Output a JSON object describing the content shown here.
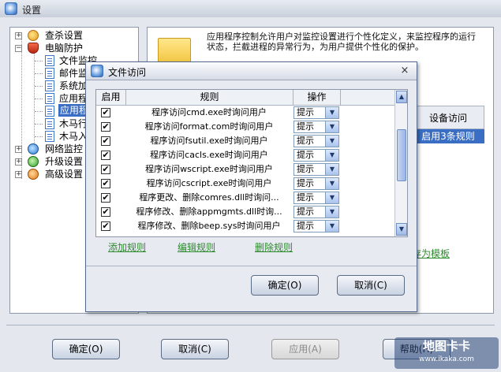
{
  "window": {
    "title": "设置"
  },
  "tree": {
    "items": [
      {
        "label": "查杀设置",
        "icon": "scan-settings-icon"
      },
      {
        "label": "电脑防护",
        "icon": "shield-icon"
      },
      {
        "label": "文件监控",
        "icon": "document-icon"
      },
      {
        "label": "邮件监控",
        "icon": "document-icon"
      },
      {
        "label": "系统加固",
        "icon": "document-icon"
      },
      {
        "label": "应用程序",
        "icon": "document-icon"
      },
      {
        "label": "应用程序",
        "icon": "document-icon"
      },
      {
        "label": "木马行为",
        "icon": "document-icon"
      },
      {
        "label": "木马入侵",
        "icon": "document-icon"
      },
      {
        "label": "网络监控",
        "icon": "network-icon"
      },
      {
        "label": "升级设置",
        "icon": "update-icon"
      },
      {
        "label": "高级设置",
        "icon": "advanced-settings-icon"
      }
    ]
  },
  "main": {
    "description": "应用程序控制允许用户对监控设置进行个性化定义，来监控程序的运行状态，拦截进程的异常行为，为用户提供个性化的保护。",
    "column_header": "设备访问",
    "selected_cell": "启用3条规则",
    "save_template_link": "存为模板"
  },
  "dialog": {
    "title": "文件访问",
    "close_symbol": "×",
    "columns": [
      "启用",
      "规则",
      "操作"
    ],
    "rows": [
      {
        "checked": "✔",
        "rule": "程序访问cmd.exe时询问用户",
        "action": "提示"
      },
      {
        "checked": "✔",
        "rule": "程序访问format.com时询问用户",
        "action": "提示"
      },
      {
        "checked": "✔",
        "rule": "程序访问fsutil.exe时询问用户",
        "action": "提示"
      },
      {
        "checked": "✔",
        "rule": "程序访问cacls.exe时询问用户",
        "action": "提示"
      },
      {
        "checked": "✔",
        "rule": "程序访问wscript.exe时询问用户",
        "action": "提示"
      },
      {
        "checked": "✔",
        "rule": "程序访问cscript.exe时询问用户",
        "action": "提示"
      },
      {
        "checked": "✔",
        "rule": "程序更改、删除comres.dll时询问...",
        "action": "提示"
      },
      {
        "checked": "✔",
        "rule": "程序修改、删除appmgmts.dll时询...",
        "action": "提示"
      },
      {
        "checked": "✔",
        "rule": "程序修改、删除beep.sys时询问用户",
        "action": "提示"
      }
    ],
    "links": {
      "add": "添加规则",
      "edit": "编辑规则",
      "delete": "删除规则"
    },
    "buttons": {
      "ok": "确定(O)",
      "cancel": "取消(C)"
    }
  },
  "footer": {
    "buttons": {
      "ok": "确定(O)",
      "cancel": "取消(C)",
      "apply": "应用(A)",
      "help": "帮助(H)"
    }
  },
  "watermark": {
    "text": "地图卡卡",
    "sub": "www.ikaka.com"
  },
  "colors": {
    "link": "#2f8a2f",
    "selection": "#3a6ec4",
    "border": "#8c98aa"
  }
}
